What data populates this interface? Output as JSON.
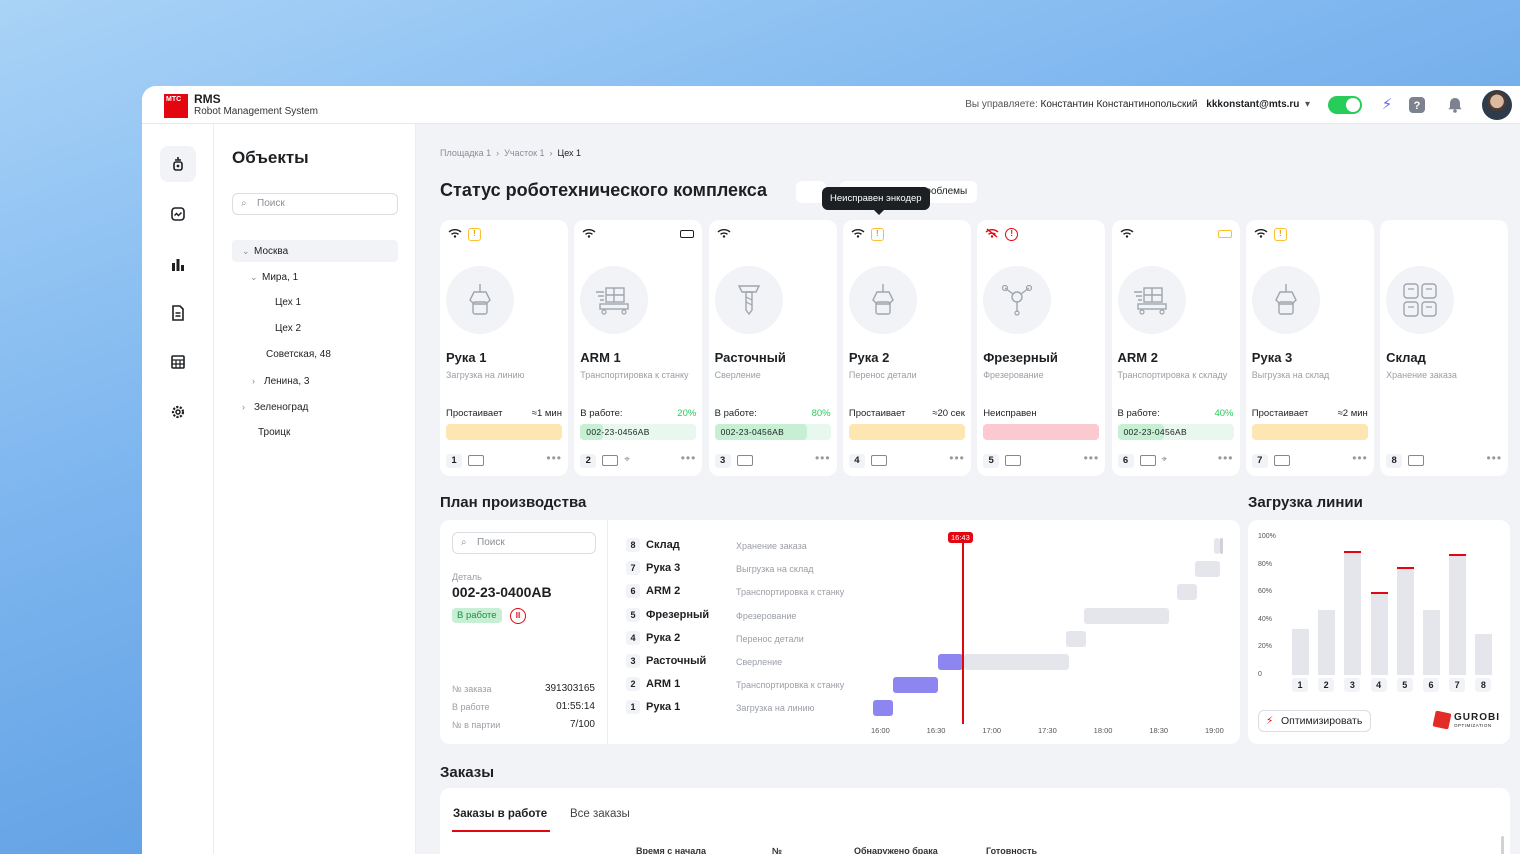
{
  "app": {
    "logo_mark": "МТС",
    "title": "RMS",
    "subtitle": "Robot Management System"
  },
  "header": {
    "manage_label": "Вы управляете:",
    "user_name": "Константин Константинопольский",
    "user_email": "kkkonstant@mts.ru",
    "icons": [
      "toggle-icon",
      "bolt-icon",
      "help-icon",
      "bell-icon",
      "avatar"
    ]
  },
  "rail": [
    "robot-icon",
    "monitor-icon",
    "chart-icon",
    "doc-icon",
    "calendar-icon",
    "gear-icon"
  ],
  "objects": {
    "title": "Объекты",
    "search_placeholder": "Поиск",
    "tree": [
      {
        "label": "Москва",
        "level": 0,
        "expanded": true,
        "selected": true
      },
      {
        "label": "Мира, 1",
        "level": 1,
        "expanded": true
      },
      {
        "label": "Цех 1",
        "level": 2
      },
      {
        "label": "Цех 2",
        "level": 2
      },
      {
        "label": "Советская, 48",
        "level": 1
      },
      {
        "label": "Ленина, 3",
        "level": 1,
        "collapsed": true
      },
      {
        "label": "Зеленоград",
        "level": 0,
        "collapsed": true
      },
      {
        "label": "Троицк",
        "level": 0
      }
    ]
  },
  "breadcrumb": [
    "Площадка 1",
    "Участок 1",
    "Цех 1"
  ],
  "status": {
    "title": "Статус роботехнического комплекса",
    "chip_problems": "ы проблемы",
    "tooltip": "Неисправен энкодер",
    "cards": [
      {
        "name": "Рука 1",
        "desc": "Загрузка на линию",
        "status": "Простаивает",
        "value": "≈1 мин",
        "bar": "yellow",
        "bar_text": "",
        "num": "1",
        "wifi": true,
        "warn": "yellow",
        "pin": false
      },
      {
        "name": "ARM 1",
        "desc": "Транспортировка к станку",
        "status": "В работе:",
        "value": "20%",
        "bar": "green",
        "fill": 0.2,
        "bar_text": "002-23-0456AB",
        "num": "2",
        "wifi": true,
        "battery": "full",
        "pin": true
      },
      {
        "name": "Расточный",
        "desc": "Сверление",
        "status": "В работе:",
        "value": "80%",
        "bar": "green",
        "fill": 0.8,
        "bar_text": "002-23-0456AB",
        "num": "3",
        "wifi": true,
        "pin": false
      },
      {
        "name": "Рука 2",
        "desc": "Перенос детали",
        "status": "Простаивает",
        "value": "≈20 сек",
        "bar": "yellow",
        "bar_text": "",
        "num": "4",
        "wifi": true,
        "warn": "yellow",
        "pin": false
      },
      {
        "name": "Фрезерный",
        "desc": "Фрезерование",
        "status": "Неисправен",
        "value": "",
        "bar": "red",
        "bar_text": "",
        "num": "5",
        "wifi": false,
        "warn": "red",
        "pin": false
      },
      {
        "name": "ARM 2",
        "desc": "Транспортировка к складу",
        "status": "В работе:",
        "value": "40%",
        "bar": "green",
        "fill": 0.4,
        "bar_text": "002-23-0456AB",
        "num": "6",
        "wifi": true,
        "battery": "low",
        "pin": true
      },
      {
        "name": "Рука 3",
        "desc": "Выгрузка на склад",
        "status": "Простаивает",
        "value": "≈2 мин",
        "bar": "yellow",
        "bar_text": "",
        "num": "7",
        "wifi": true,
        "warn": "yellow",
        "pin": false
      },
      {
        "name": "Склад",
        "desc": "Хранение заказа",
        "status": "",
        "value": "",
        "bar": "none",
        "bar_text": "",
        "num": "8",
        "wifi": false,
        "pin": false
      }
    ]
  },
  "plan": {
    "title": "План производства",
    "search_placeholder": "Поиск",
    "detail_label": "Деталь",
    "detail_value": "002-23-0400AB",
    "badge": "В работе",
    "order_label": "№ заказа",
    "order_value": "391303165",
    "work_label": "В работе",
    "work_value": "01:55:14",
    "batch_label": "№ в партии",
    "batch_value": "7/100",
    "now_label": "16:43",
    "rows": [
      {
        "num": "8",
        "name": "Склад",
        "desc": "Хранение заказа"
      },
      {
        "num": "7",
        "name": "Рука 3",
        "desc": "Выгрузка на склад"
      },
      {
        "num": "6",
        "name": "ARM 2",
        "desc": "Транспортировка к станку"
      },
      {
        "num": "5",
        "name": "Фрезерный",
        "desc": "Фрезерование"
      },
      {
        "num": "4",
        "name": "Рука 2",
        "desc": "Перенос детали"
      },
      {
        "num": "3",
        "name": "Расточный",
        "desc": "Сверление"
      },
      {
        "num": "2",
        "name": "ARM 1",
        "desc": "Транспортировка к станку"
      },
      {
        "num": "1",
        "name": "Рука 1",
        "desc": "Загрузка на линию"
      }
    ],
    "ticks": [
      "16:00",
      "16:30",
      "17:00",
      "17:30",
      "18:00",
      "18:30",
      "19:00"
    ],
    "gantt": [
      {
        "row": 0,
        "start": "19:00",
        "end": "19:01",
        "kind": "grey"
      },
      {
        "row": 1,
        "start": "18:50",
        "end": "19:03",
        "kind": "grey"
      },
      {
        "row": 2,
        "start": "18:40",
        "end": "18:51",
        "kind": "grey"
      },
      {
        "row": 3,
        "start": "17:50",
        "end": "18:36",
        "kind": "grey"
      },
      {
        "row": 4,
        "start": "17:40",
        "end": "17:51",
        "kind": "grey"
      },
      {
        "row": 5,
        "start": "16:31",
        "end": "16:45",
        "kind": "done"
      },
      {
        "row": 5,
        "start": "16:45",
        "end": "17:42",
        "kind": "grey"
      },
      {
        "row": 6,
        "start": "16:07",
        "end": "16:31",
        "kind": "done"
      },
      {
        "row": 7,
        "start": "15:56",
        "end": "16:07",
        "kind": "done"
      }
    ]
  },
  "load": {
    "title": "Загрузка линии",
    "yticks": [
      "100%",
      "80%",
      "60%",
      "40%",
      "20%",
      "0"
    ],
    "values": [
      33,
      47,
      90,
      60,
      78,
      47,
      88,
      30
    ],
    "labels": [
      "1",
      "2",
      "3",
      "4",
      "5",
      "6",
      "7",
      "8"
    ],
    "capped": [
      false,
      false,
      true,
      true,
      true,
      false,
      true,
      false
    ],
    "optimize_label": "Оптимизировать",
    "brand": "GUROBI",
    "brand_sub": "OPTIMIZATION"
  },
  "orders": {
    "title": "Заказы",
    "tabs": [
      "Заказы в работе",
      "Все заказы"
    ],
    "columns": [
      "Время с начала",
      "№",
      "Обнаружено брака",
      "Готовность"
    ]
  }
}
